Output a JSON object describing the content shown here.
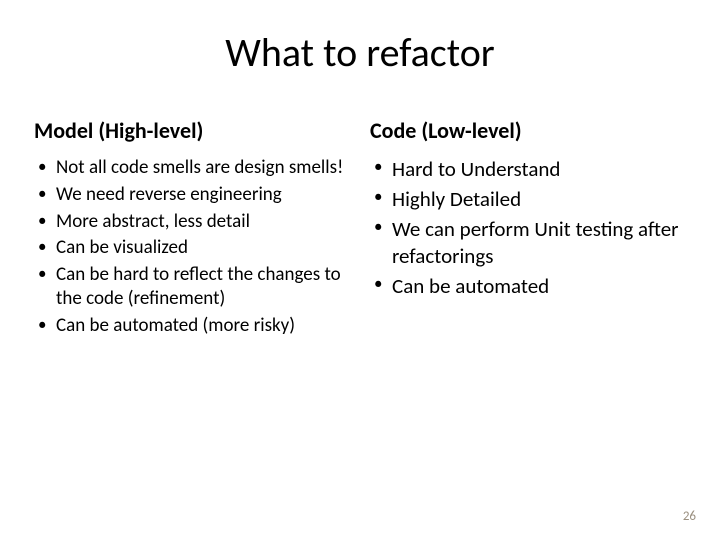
{
  "title": "What to refactor",
  "left": {
    "heading": "Model (High-level)",
    "items": [
      "Not all code smells are design smells!",
      "We need reverse engineering",
      "More abstract, less detail",
      "Can be visualized",
      "Can be hard to reflect the changes to the code (refinement)",
      "Can be automated (more risky)"
    ]
  },
  "right": {
    "heading": "Code (Low-level)",
    "items": [
      "Hard to Understand",
      "Highly Detailed",
      "We can perform Unit testing after refactorings",
      "Can be automated"
    ]
  },
  "page_number": "26"
}
